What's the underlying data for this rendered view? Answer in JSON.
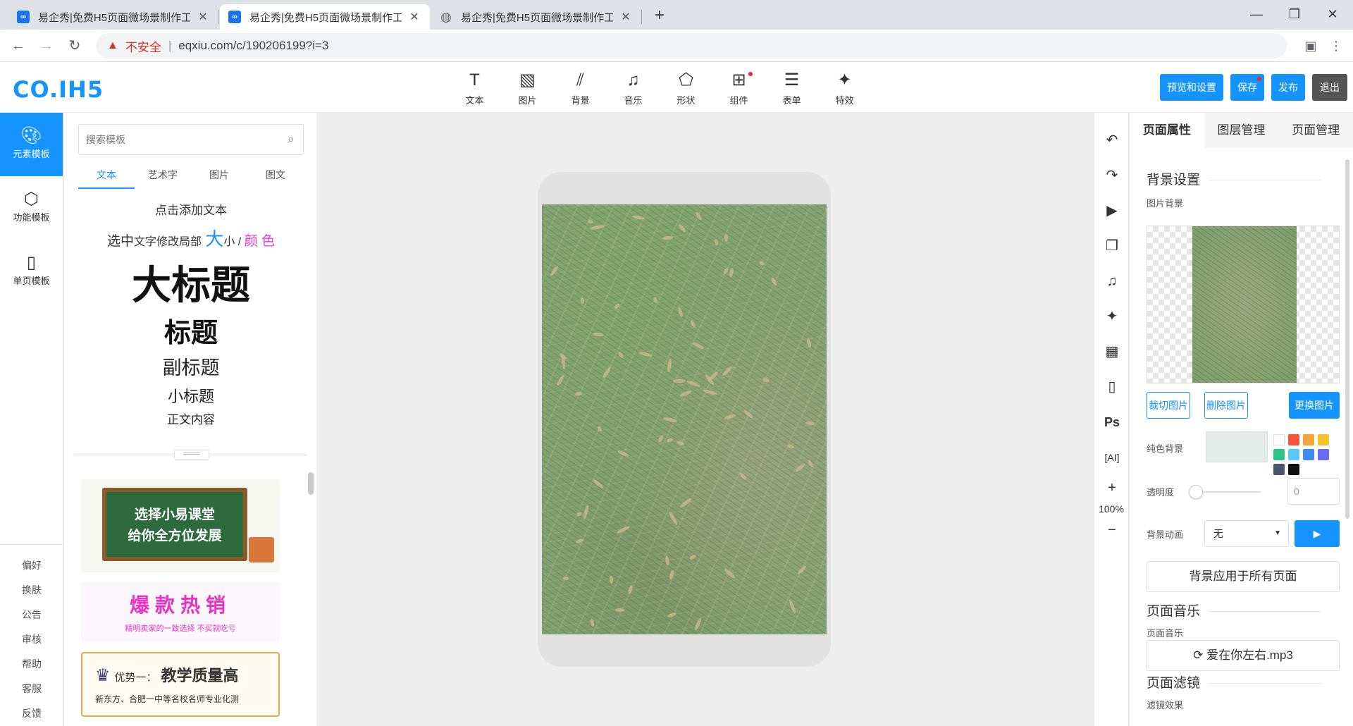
{
  "browser": {
    "tabs": [
      {
        "title": "易企秀|免费H5页面微场景制作工",
        "fav": "∞",
        "active": false
      },
      {
        "title": "易企秀|免费H5页面微场景制作工",
        "fav": "∞",
        "active": true
      },
      {
        "title": "易企秀|免费H5页面微场景制作工",
        "fav": "globe-icon",
        "active": false
      }
    ],
    "new_tab": "+",
    "address": {
      "insecure_label": "不安全",
      "separator": "|",
      "url": "eqxiu.com/c/190206199?i=3"
    }
  },
  "header": {
    "logo": "CO.IH5",
    "tools": [
      {
        "icon": "text-icon",
        "glyph": "T",
        "label": "文本"
      },
      {
        "icon": "image-icon",
        "glyph": "▧",
        "label": "图片"
      },
      {
        "icon": "background-icon",
        "glyph": "⫽",
        "label": "背景"
      },
      {
        "icon": "music-icon",
        "glyph": "♫",
        "label": "音乐"
      },
      {
        "icon": "shape-icon",
        "glyph": "⬠",
        "label": "形状"
      },
      {
        "icon": "component-icon",
        "glyph": "⊞",
        "label": "组件",
        "dot": true
      },
      {
        "icon": "form-icon",
        "glyph": "☰",
        "label": "表单"
      },
      {
        "icon": "effect-icon",
        "glyph": "✦",
        "label": "特效"
      }
    ],
    "buttons": {
      "preview": "预览和设置",
      "save": "保存",
      "publish": "发布",
      "exit": "退出"
    }
  },
  "rail": {
    "items": [
      {
        "icon": "palette-icon",
        "glyph": "☺",
        "label": "元素模板",
        "active": true
      },
      {
        "icon": "cube-icon",
        "glyph": "⬡",
        "label": "功能模板",
        "active": false
      },
      {
        "icon": "page-icon",
        "glyph": "▯",
        "label": "单页模板",
        "active": false
      }
    ],
    "links": [
      "偏好",
      "换肤",
      "公告",
      "审核",
      "帮助",
      "客服",
      "反馈"
    ]
  },
  "templates": {
    "search_placeholder": "搜索模板",
    "tabs": [
      "文本",
      "艺术字",
      "图片",
      "图文"
    ],
    "samples": {
      "add": "点击添加文本",
      "select_a": "选中",
      "select_b": "文字修改局部",
      "select_big": "大",
      "select_c": "小 / ",
      "select_color": "颜 色",
      "h1": "大标题",
      "h2": "标题",
      "h3": "副标题",
      "h4": "小标题",
      "body": "正文内容"
    },
    "handle": "═══",
    "card1": {
      "line1": "选择小易课堂",
      "line2": "给你全方位发展"
    },
    "card2": {
      "title": "爆款热销",
      "sub": "精明卖家的一致选择 不买就吃亏"
    },
    "card3": {
      "prefix": "优势一：",
      "title": "教学质量高",
      "text": "新东方、合肥一中等名校名师专业化测"
    }
  },
  "right_tools": {
    "items": [
      {
        "icon": "undo-icon",
        "glyph": "↶"
      },
      {
        "icon": "redo-icon",
        "glyph": "↷"
      },
      {
        "icon": "play-icon",
        "glyph": "▶"
      },
      {
        "icon": "pages-icon",
        "glyph": "❐"
      },
      {
        "icon": "music-note-icon",
        "glyph": "♫"
      },
      {
        "icon": "sparkle-icon",
        "glyph": "✦"
      },
      {
        "icon": "grid-icon",
        "glyph": "▦"
      },
      {
        "icon": "phone-icon",
        "glyph": "▯"
      },
      {
        "icon": "ps-icon",
        "glyph": "Ps"
      },
      {
        "icon": "ai-icon",
        "glyph": "[AI]"
      }
    ],
    "zoom_in": "+",
    "zoom": "100%",
    "zoom_out": "−"
  },
  "props": {
    "tabs": [
      "页面属性",
      "图层管理",
      "页面管理"
    ],
    "bg_section": "背景设置",
    "img_bg_label": "图片背景",
    "buttons": {
      "crop": "裁切图片",
      "delete": "删除图片",
      "replace": "更换图片"
    },
    "solid_label": "纯色背景",
    "colors": [
      "#ffffff",
      "#f5553a",
      "#f5a53a",
      "#f5c32a",
      "#2ac58a",
      "#5ac8fa",
      "#3a8df5",
      "#6a6af5",
      "#4a5670",
      "#111111"
    ],
    "opacity_label": "透明度",
    "opacity_value": "0",
    "opacity_level": 0,
    "anim_label": "背景动画",
    "anim_value": "无",
    "anim_play": "▶",
    "apply_all": "背景应用于所有页面",
    "music_section": "页面音乐",
    "music_label": "页面音乐",
    "music_file": "⟳  爱在你左右.mp3",
    "filter_section": "页面滤镜",
    "filter_label": "滤镜效果"
  }
}
